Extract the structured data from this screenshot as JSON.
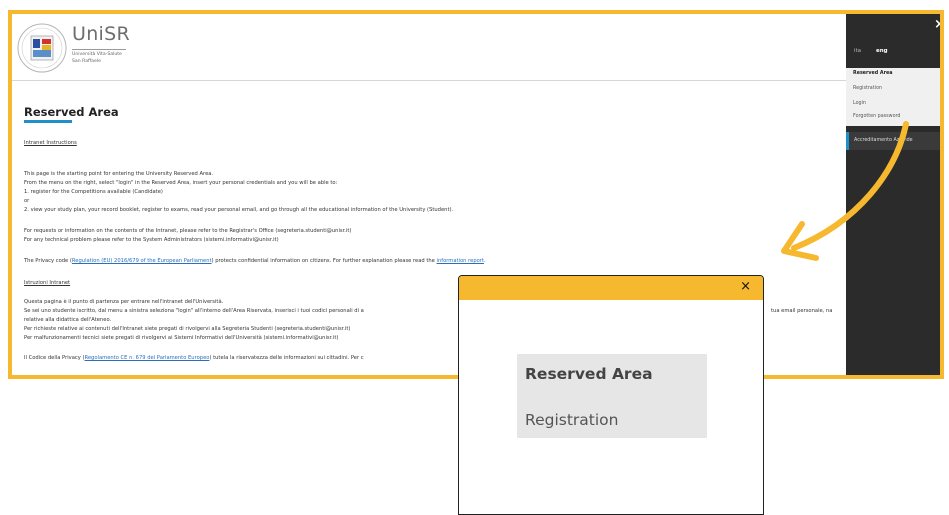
{
  "brand": {
    "name": "UniSR",
    "subtitle_line1": "Università Vita-Salute",
    "subtitle_line2": "San Raffaele"
  },
  "main": {
    "title": "Reserved Area",
    "intranet_instructions": "Intranet Instructions",
    "para1_line1": "This page is the starting point for entering the University Reserved Area.",
    "para1_line2": "From the menu on the right, select \"login\" in the Reserved Area, insert your personal credentials and you will be able to:",
    "para1_line3": "1. register for the Competitions available (Candidate)",
    "para1_line4": "or",
    "para1_line5": "2. view your study plan, your record booklet, register to exams, read your personal email, and go through all the educational information of the University (Student).",
    "para2_line1": "For requests or information on the contents of the Intranet, please refer to the Registrar's Office (segreteria.studenti@unisr.it)",
    "para2_line2": "For any technical problem please refer to the System Administrators (sistemi.informativi@unisr.it)",
    "privacy_pre": "The Privacy code (",
    "privacy_link": "Regulation (EU) 2016/679 of the European Parliament",
    "privacy_mid": ") protects confidential information on citizens. For further explanation please read the ",
    "privacy_link2": "information report",
    "privacy_end": ".",
    "istruzioni": "Istruzioni Intranet",
    "it_line1": "Questa pagina è il punto di partenza per entrare nell'intranet dell'Università.",
    "it_line2a": "Se sei uno studente iscritto, dal menu a sinistra seleziona \"login\" all'interno dell'Area Riservata, inserisci i tuoi codici personali di a",
    "it_line2b": "tua email personale, na",
    "it_line3": "relative alla didattica dell'Ateneo.",
    "it_line4": "Per richieste relative ai contenuti dell'Intranet siete pregati di rivolgervi alla Segreteria Studenti (segreteria.studenti@unisr.it)",
    "it_line5": "Per malfunzionamenti tecnici siete pregati di rivolgervi ai Sistemi Informativi dell'Università (sistemi.informativi@unisr.it)",
    "it_privacy_pre": "Il Codice della Privacy (",
    "it_privacy_link": "Regolamento CE n. 679 del Parlamento Europeo",
    "it_privacy_post": ") tutela la riservatezza delle informazioni sui cittadini. Per c"
  },
  "sidebar": {
    "close": "×",
    "lang_ita": "ita",
    "lang_eng": "eng",
    "menu": {
      "reserved": "Reserved Area",
      "registration": "Registration",
      "login": "Login",
      "forgot": "Forgotten password"
    },
    "accreditamento": "Accreditamento Aziende",
    "chevron": "›"
  },
  "zoom": {
    "close": "×",
    "reserved": "Reserved Area",
    "registration": "Registration"
  },
  "colors": {
    "accent_orange": "#f5b82e",
    "sidebar_dark": "#2b2b2b",
    "link_blue": "#2a6fbf",
    "title_underline": "#1f8fc9"
  }
}
